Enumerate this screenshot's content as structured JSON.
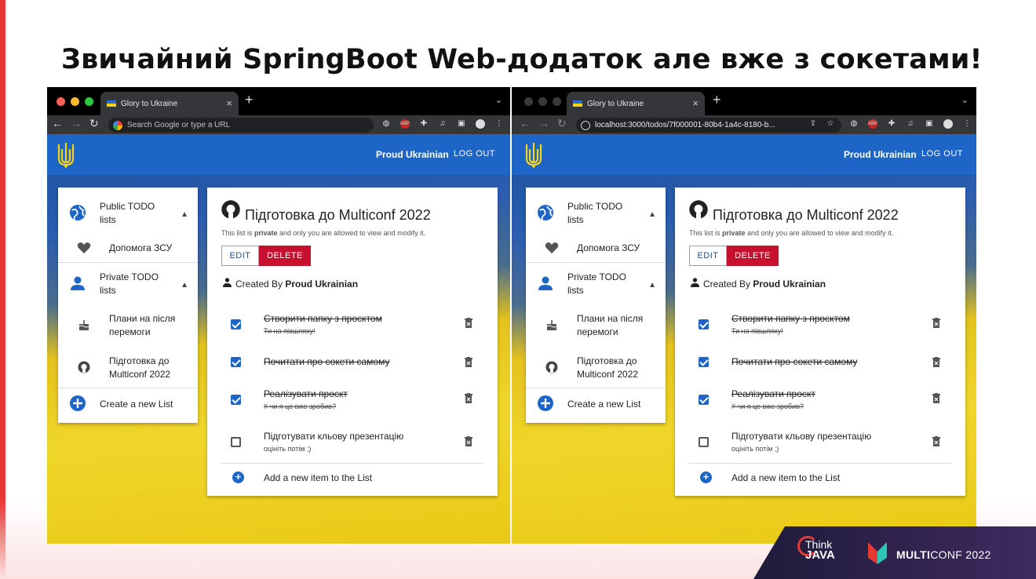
{
  "slide": {
    "title": "Звичайний SpringBoot Web-додаток але вже з сокетами!"
  },
  "colors": {
    "accent_red": "#e53935",
    "app_bar_blue": "#1e65c8",
    "delete_red": "#c8102e",
    "flag_blue": "#2a5db0",
    "flag_yellow": "#f0d62a"
  },
  "windows": [
    {
      "tab_title": "Glory to Ukraine",
      "address_text": "Search Google or type a URL",
      "address_type": "search"
    },
    {
      "tab_title": "Glory to Ukraine",
      "address_text": "localhost:3000/todos/7f000001-80b4-1a4c-8180-b...",
      "address_type": "url"
    }
  ],
  "app": {
    "user": "Proud Ukrainian",
    "logout": "LOG OUT",
    "sidebar": {
      "public_header": "Public TODO lists",
      "public_items": [
        {
          "label": "Допомога ЗСУ",
          "icon": "heart-icon"
        }
      ],
      "private_header": "Private TODO lists",
      "private_items": [
        {
          "label": "Плани на після перемоги",
          "icon": "cake-icon"
        },
        {
          "label": "Підготовка до Multiconf 2022",
          "icon": "github-icon"
        }
      ],
      "create": "Create a new List"
    },
    "list": {
      "title": "Підготовка до Multiconf 2022",
      "desc_prefix": "This list is ",
      "desc_strong": "private",
      "desc_suffix": " and only you are allowed to view and modify it.",
      "edit": "EDIT",
      "delete": "DELETE",
      "created_by_label": "Created By ",
      "created_by": "Proud Ukrainian",
      "items": [
        {
          "title": "Створити папку з проєктом",
          "sub": "Ти на півшляху!",
          "done": true
        },
        {
          "title": "Почитати про сокети самому",
          "sub": "",
          "done": true
        },
        {
          "title": "Реалізувати проєкт",
          "sub": "# чи я це вже зробив?",
          "done": true
        },
        {
          "title": "Підготувати кльову презентацію",
          "sub": "оцініть потім ;)",
          "done": false
        }
      ],
      "add_item": "Add a new item to the List"
    }
  },
  "branding": {
    "think": "Think",
    "java": "JAVA",
    "multi": "MULTI",
    "conf": "CONF 2022"
  }
}
